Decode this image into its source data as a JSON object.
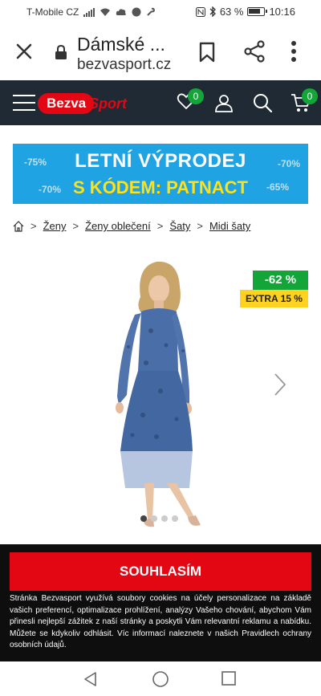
{
  "status_bar": {
    "carrier": "T-Mobile CZ",
    "battery": "63 %",
    "time": "10:16"
  },
  "browser": {
    "page_title": "Dámské ...",
    "domain": "bezvasport.cz"
  },
  "site_header": {
    "logo_left": "Bezva",
    "logo_right": "Sport",
    "wishlist_count": "0",
    "cart_count": "0"
  },
  "banner": {
    "line1": "LETNÍ VÝPRODEJ",
    "line2": "S KÓDEM: PATNACT",
    "percents": [
      "-75%",
      "-70%",
      "-70%",
      "-65%"
    ]
  },
  "breadcrumb": {
    "items": [
      "Ženy",
      "Ženy oblečení",
      "Šaty",
      "Midi šaty"
    ],
    "separator": ">"
  },
  "product": {
    "discount_badge": "-62 %",
    "extra_badge": "EXTRA 15 %",
    "dress_color": "#4a6ea8"
  },
  "cookie_bar": {
    "agree_label": "SOUHLASÍM",
    "text": "Stránka Bezvasport využívá soubory cookies na účely personalizace na základě vašich preferencí, optimalizace prohlížení, analýzy Vašeho chování, abychom Vám přinesli nejlepší zážitek z naší stránky a poskytli Vám relevantní reklamu a nabídku. Můžete se kdykoliv odhlásit. Víc informací naleznete v našich Pravidlech ochrany osobních údajů."
  },
  "colors": {
    "brand_red": "#e30613",
    "header_dark": "#1f2a34",
    "banner_blue": "#1fa3e3",
    "badge_green": "#13a538",
    "badge_yellow": "#ffd21f"
  }
}
